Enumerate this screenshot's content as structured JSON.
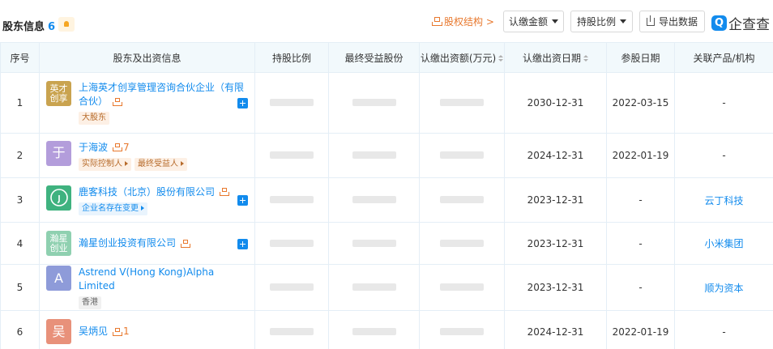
{
  "header": {
    "title": "股东信息",
    "count": "6",
    "equity_link": "股权结构 >",
    "btn_amount": "认缴金额",
    "btn_ratio": "持股比例",
    "btn_export": "导出数据",
    "logo_text": "企查查",
    "logo_mark": "Q"
  },
  "columns": {
    "index": "序号",
    "shareholder": "股东及出资信息",
    "ratio": "持股比例",
    "final_benefit": "最终受益股份",
    "subscribed_amount": "认缴出资额(万元)",
    "subscribed_date": "认缴出资日期",
    "join_date": "参股日期",
    "related": "关联产品/机构"
  },
  "rows": [
    {
      "index": "1",
      "avatar": "英才\n创享",
      "avatar_color": "#c9a34f",
      "name": "上海英才创享管理咨询合伙企业（有限合伙）",
      "tags": [
        "大股东"
      ],
      "sub_date": "2030-12-31",
      "join_date": "2022-03-15",
      "related": "-"
    },
    {
      "index": "2",
      "avatar": "于",
      "avatar_color": "#b39ddb",
      "name": "于海波",
      "count": "7",
      "tags": [
        "实际控制人",
        "最终受益人"
      ],
      "sub_date": "2024-12-31",
      "join_date": "2022-01-19",
      "related": "-"
    },
    {
      "index": "3",
      "avatar": "",
      "avatar_color": "#3fb27f",
      "name": "鹿客科技（北京）股份有限公司",
      "tags": [
        "企业名存在变更"
      ],
      "sub_date": "2023-12-31",
      "join_date": "-",
      "related": "云丁科技"
    },
    {
      "index": "4",
      "avatar": "瀚星\n创业",
      "avatar_color": "#8fd0b0",
      "name": "瀚星创业投资有限公司",
      "tags": [],
      "sub_date": "2023-12-31",
      "join_date": "-",
      "related": "小米集团"
    },
    {
      "index": "5",
      "avatar": "A",
      "avatar_color": "#8e9bd9",
      "name": "Astrend V(Hong Kong)Alpha Limited",
      "tags": [
        "香港"
      ],
      "sub_date": "2023-12-31",
      "join_date": "-",
      "related": "顺为资本"
    },
    {
      "index": "6",
      "avatar": "吴",
      "avatar_color": "#e8917a",
      "name": "吴炳见",
      "count": "1",
      "tags": [],
      "sub_date": "2024-12-31",
      "join_date": "2022-01-19",
      "related": "-"
    }
  ]
}
